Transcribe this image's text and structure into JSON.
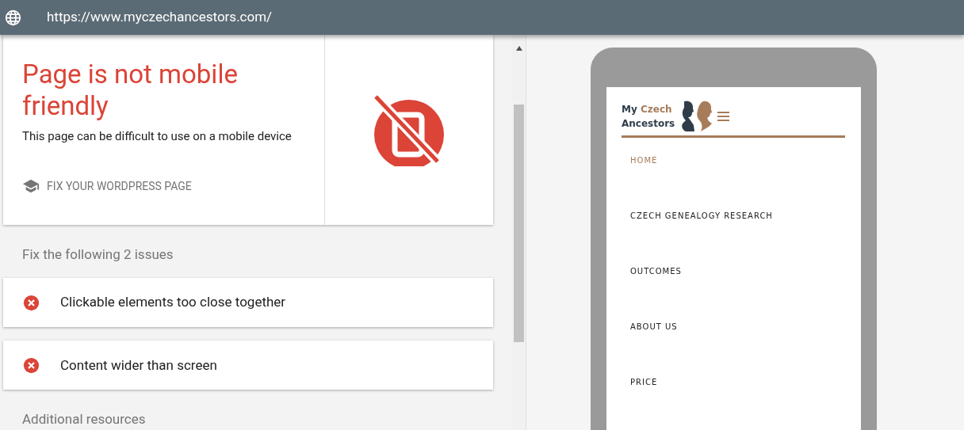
{
  "url_bar": {
    "url": "https://www.myczechancestors.com/"
  },
  "result": {
    "title": "Page is not mobile friendly",
    "description": "This page can be difficult to use on a mobile device",
    "link": "FIX YOUR WORDPRESS PAGE"
  },
  "issues_heading": "Fix the following 2 issues",
  "issues": [
    {
      "text": "Clickable elements too close together"
    },
    {
      "text": "Content wider than screen"
    }
  ],
  "resources_heading": "Additional resources",
  "phone_preview": {
    "logo": {
      "line_1_part_1": "My",
      "line_1_part_2": "Czech",
      "line_2": "Ancestors"
    },
    "menu": [
      {
        "label": "HOME",
        "selected": true
      },
      {
        "label": "CZECH GENEALOGY RESEARCH",
        "selected": false
      },
      {
        "label": "OUTCOMES",
        "selected": false
      },
      {
        "label": "ABOUT US",
        "selected": false
      },
      {
        "label": "PRICE",
        "selected": false
      }
    ]
  }
}
